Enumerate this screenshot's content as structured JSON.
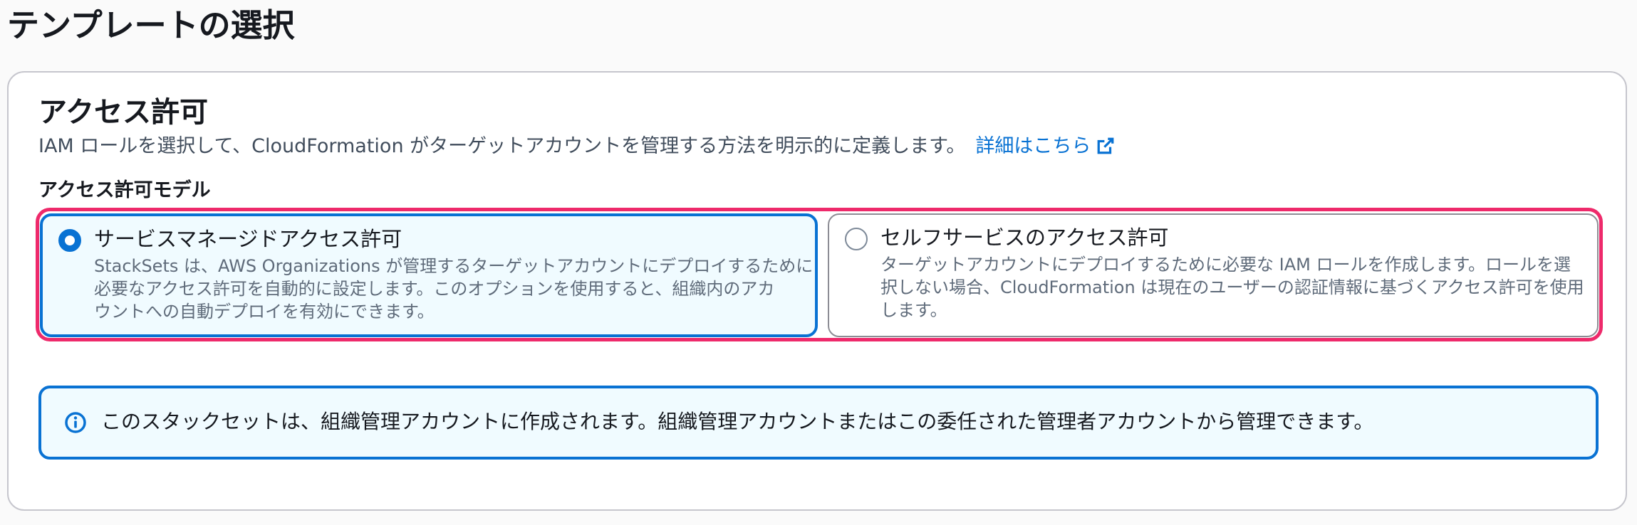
{
  "page": {
    "title": "テンプレートの選択"
  },
  "permissions": {
    "title": "アクセス許可",
    "description": "IAM ロールを選択して、CloudFormation がターゲットアカウントを管理する方法を明示的に定義します。",
    "learn_more": "詳細はこちら",
    "learn_more_icon": "external-link-icon",
    "field_label": "アクセス許可モデル",
    "options": [
      {
        "title": "サービスマネージドアクセス許可",
        "selected": true,
        "description_lines": [
          "StackSets は、AWS Organizations が管理するターゲットアカウントにデプロイするために",
          "必要なアクセス許可を自動的に設定します。このオプションを使用すると、組織内のアカ",
          "ウントへの自動デプロイを有効にできます。"
        ]
      },
      {
        "title": "セルフサービスのアクセス許可",
        "selected": false,
        "description_lines": [
          "ターゲットアカウントにデプロイするために必要な IAM ロールを作成します。ロールを選",
          "択しない場合、CloudFormation は現在のユーザーの認証情報に基づくアクセス許可を使用",
          "します。"
        ]
      }
    ],
    "info": {
      "icon": "info-icon",
      "text": "このスタックセットは、組織管理アカウントに作成されます。組織管理アカウントまたはこの委任された管理者アカウントから管理できます。"
    }
  },
  "colors": {
    "accent": "#0972d3",
    "highlight": "#ee2a6b",
    "selected_bg": "#f0fbff"
  }
}
